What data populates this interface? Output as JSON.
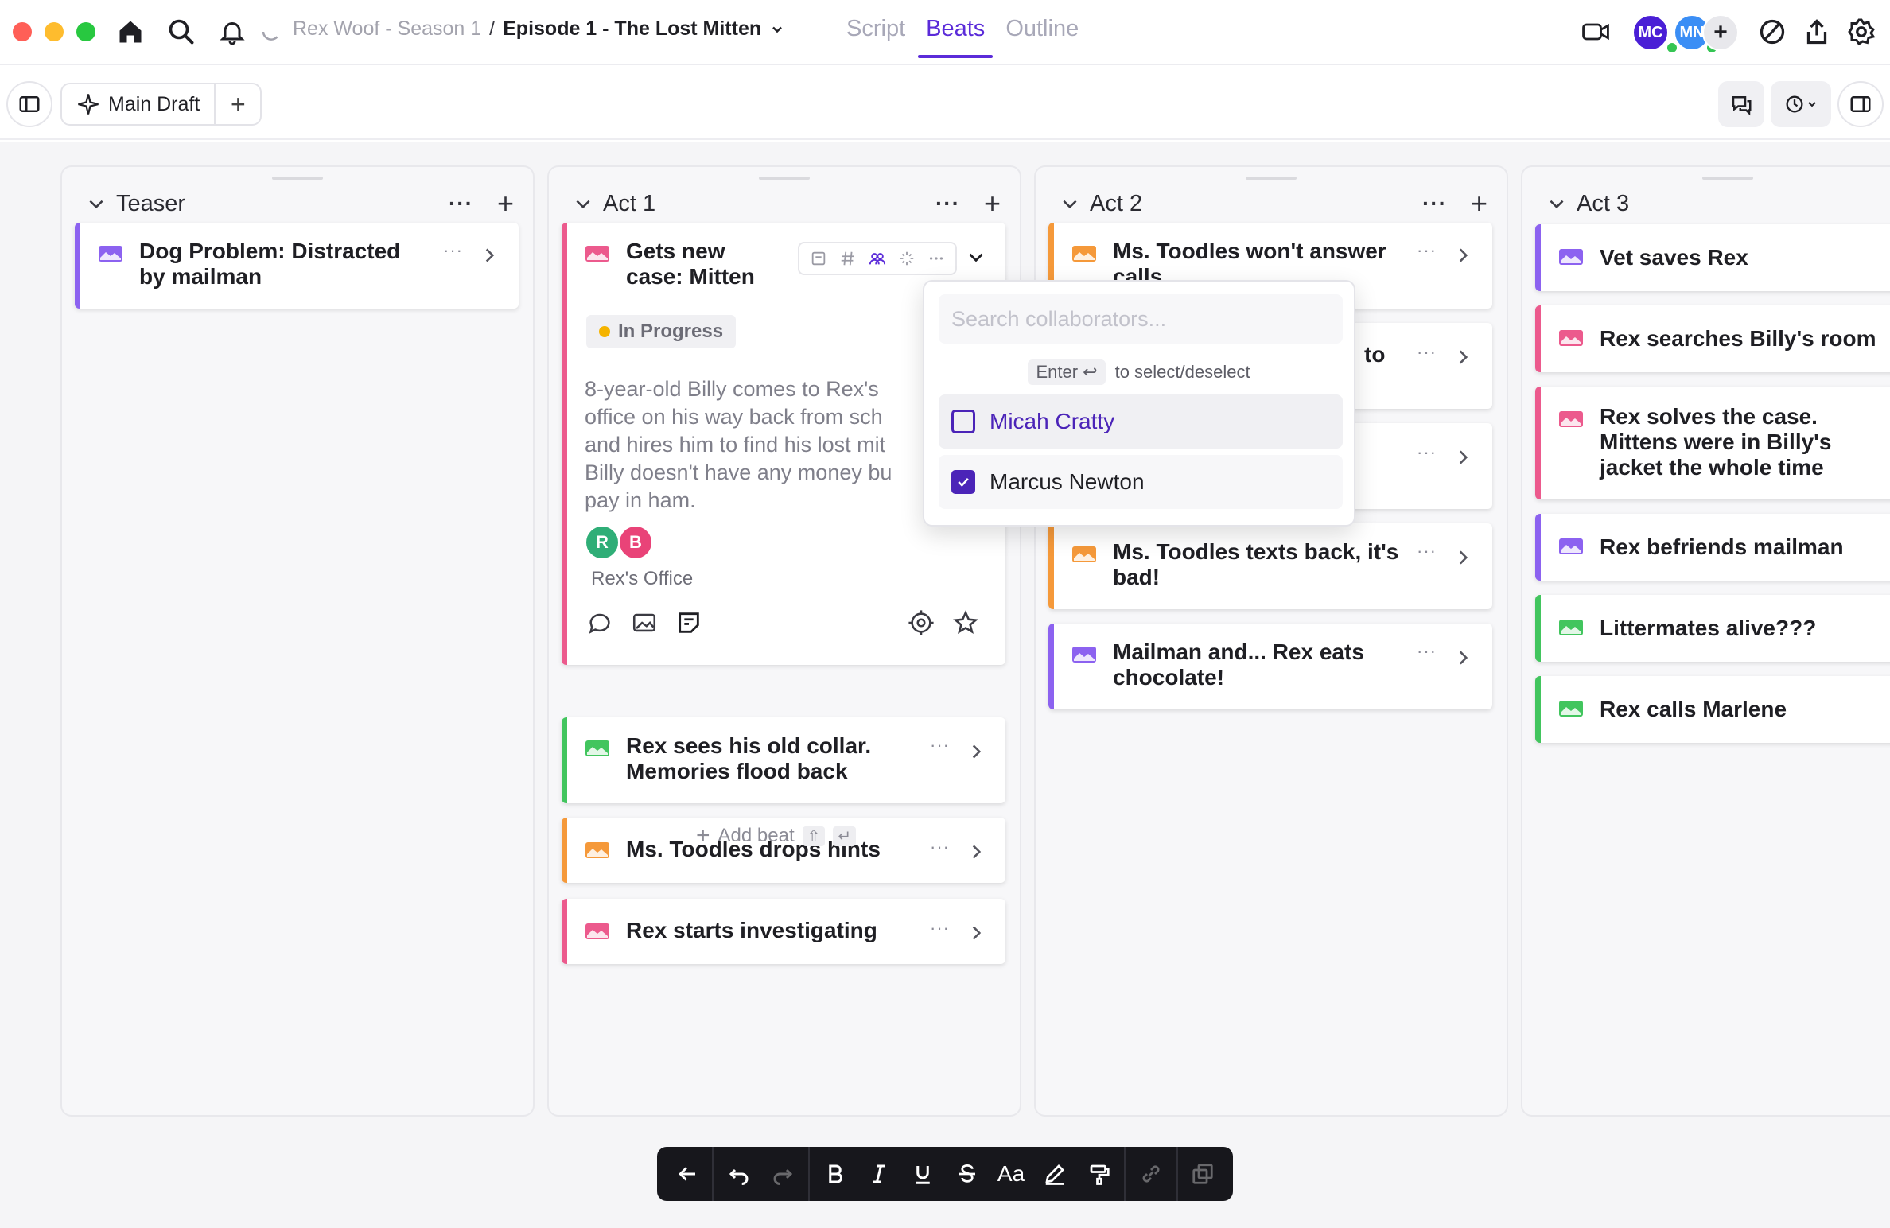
{
  "header": {
    "breadcrumb": {
      "season": "Rex Woof - Season 1",
      "separator": "/",
      "episode": "Episode 1 - The Lost Mitten"
    },
    "view_tabs": [
      {
        "label": "Script",
        "active": false
      },
      {
        "label": "Beats",
        "active": true
      },
      {
        "label": "Outline",
        "active": false
      }
    ],
    "collaborators": [
      {
        "initials": "MC",
        "color": "#4a1fd6"
      },
      {
        "initials": "MN",
        "color": "#3b8ef5"
      }
    ],
    "icons": [
      "home-icon",
      "search-icon",
      "bell-icon",
      "video-icon",
      "chart-icon",
      "share-icon",
      "gear-icon"
    ]
  },
  "toolbar": {
    "draft_label": "Main Draft",
    "add_label": "+"
  },
  "colors": {
    "accent": "#5b2bd9",
    "purple": "#8c62f0",
    "pink": "#ec5a8d",
    "orange": "#f5993a",
    "green": "#42c55e"
  },
  "columns": [
    {
      "title": "Teaser"
    },
    {
      "title": "Act 1"
    },
    {
      "title": "Act 2"
    },
    {
      "title": "Act 3"
    }
  ],
  "cards": {
    "teaser": [
      {
        "title": "Dog Problem: Distracted by mailman",
        "color": "purple"
      }
    ],
    "act1_expanded": {
      "title": "Gets new case: Mitten",
      "status": "In Progress",
      "description": "8-year-old Billy comes to Rex's\noffice on his way back from sch\nand hires him to find his lost mit\nBilly doesn't have any money bu\npay in ham.",
      "assignees": [
        {
          "initials": "R",
          "color": "#2fae77"
        },
        {
          "initials": "B",
          "color": "#e94378"
        }
      ],
      "location": "Rex's Office"
    },
    "add_beat": {
      "label": "Add beat",
      "shortcut": "⇧",
      "enter": "↵"
    },
    "act1": [
      {
        "title": "Rex sees his old collar. Memories flood back",
        "color": "green"
      },
      {
        "title": "Ms. Toodles drops hints",
        "color": "orange"
      },
      {
        "title": "Rex starts investigating",
        "color": "pink"
      }
    ],
    "act2": [
      {
        "title": "Ms. Toodles won't answer calls",
        "color": "orange"
      },
      {
        "title": "to",
        "color": "orange"
      },
      {
        "title": "",
        "color": "purple"
      },
      {
        "title": "Ms. Toodles texts back, it's bad!",
        "color": "orange"
      },
      {
        "title": "Mailman and... Rex eats chocolate!",
        "color": "purple"
      }
    ],
    "act3": [
      {
        "title": "Vet saves Rex",
        "color": "purple"
      },
      {
        "title": "Rex searches Billy's room",
        "color": "pink"
      },
      {
        "title": "Rex solves the case. Mittens were in Billy's jacket the whole time",
        "color": "pink"
      },
      {
        "title": "Rex befriends mailman",
        "color": "purple"
      },
      {
        "title": "Littermates alive???",
        "color": "green"
      },
      {
        "title": "Rex calls Marlene",
        "color": "green"
      }
    ]
  },
  "collab_dropdown": {
    "placeholder": "Search collaborators...",
    "hint_key": "Enter ↩",
    "hint_text": "to select/deselect",
    "options": [
      {
        "name": "Micah Cratty",
        "checked": false
      },
      {
        "name": "Marcus Newton",
        "checked": true
      }
    ]
  },
  "format_bar": {
    "font_size_label": "Aa"
  }
}
